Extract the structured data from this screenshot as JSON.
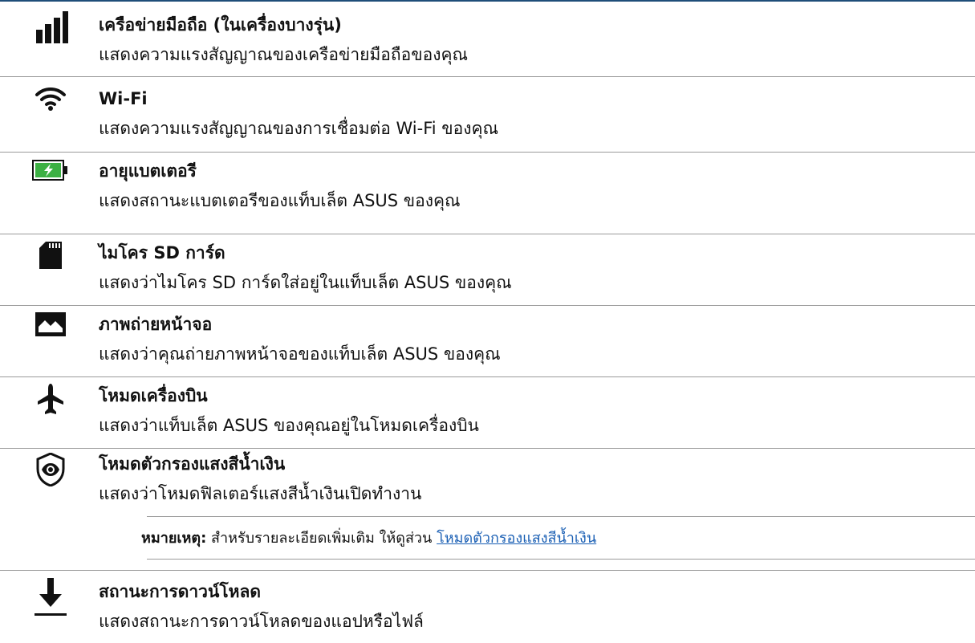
{
  "items": [
    {
      "icon": "signal-bars-icon",
      "title": "เครือข่ายมือถือ (ในเครื่องบางรุ่น)",
      "description": "แสดงความแรงสัญญาณของเครือข่ายมือถือของคุณ"
    },
    {
      "icon": "wifi-icon",
      "title": "Wi-Fi",
      "description": "แสดงความแรงสัญญาณของการเชื่อมต่อ Wi-Fi ของคุณ"
    },
    {
      "icon": "battery-charging-icon",
      "title": "อายุแบตเตอรี",
      "description": "แสดงสถานะแบตเตอรีของแท็บเล็ต ASUS ของคุณ"
    },
    {
      "icon": "sd-card-icon",
      "title": "ไมโคร SD การ์ด",
      "description": "แสดงว่าไมโคร SD การ์ดใส่อยู่ในแท็บเล็ต ASUS ของคุณ"
    },
    {
      "icon": "screenshot-image-icon",
      "title": "ภาพถ่ายหน้าจอ",
      "description": "แสดงว่าคุณถ่ายภาพหน้าจอของแท็บเล็ต ASUS ของคุณ"
    },
    {
      "icon": "airplane-icon",
      "title": "โหมดเครื่องบิน",
      "description": "แสดงว่าแท็บเล็ต ASUS ของคุณอยู่ในโหมดเครื่องบิน"
    },
    {
      "icon": "eye-shield-icon",
      "title": "โหมดตัวกรองแสงสีน้ำเงิน",
      "description": "แสดงว่าโหมดฟิลเตอร์แสงสีน้ำเงินเปิดทำงาน"
    },
    {
      "icon": "download-icon",
      "title": "สถานะการดาวน์โหลด",
      "description": "แสดงสถานะการดาวน์โหลดของแอปหรือไฟล์"
    }
  ],
  "note": {
    "label": "หมายเหตุ:",
    "text": " สำหรับรายละเอียดเพิ่มเติม ให้ดูส่วน ",
    "link": "โหมดตัวกรองแสงสีน้ำเงิน"
  },
  "colors": {
    "rule": "#1f4e79",
    "battery": "#3cb043",
    "link": "#1a5fb4"
  }
}
